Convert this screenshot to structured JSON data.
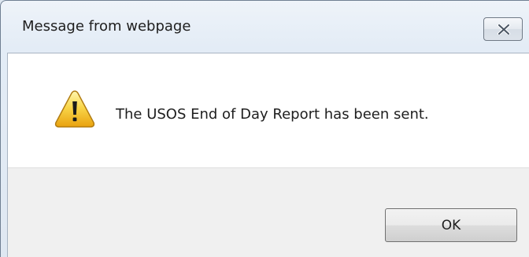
{
  "window": {
    "title": "Message from webpage",
    "close_icon": "close-icon"
  },
  "message": {
    "icon": "warning-icon",
    "text": "The USOS End of Day Report has been sent."
  },
  "buttons": {
    "ok_label": "OK"
  }
}
